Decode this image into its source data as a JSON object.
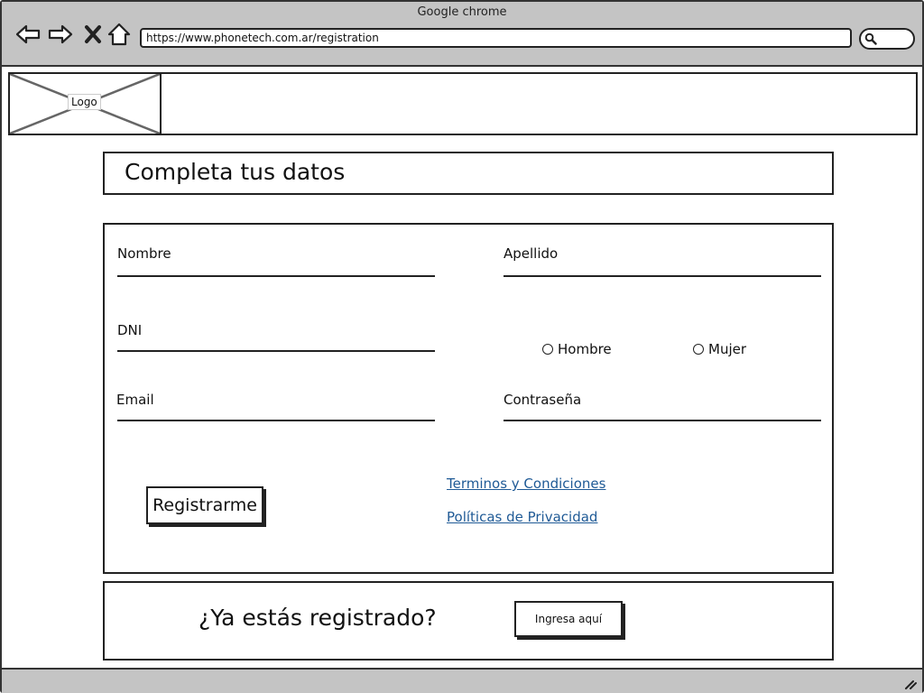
{
  "browser": {
    "window_title": "Google chrome",
    "url": "https://www.phonetech.com.ar/registration",
    "icons": [
      "back-arrow-icon",
      "forward-arrow-icon",
      "close-x-icon",
      "home-icon",
      "search-icon"
    ]
  },
  "header": {
    "logo_label": "Logo"
  },
  "page": {
    "title": "Completa tus datos"
  },
  "form": {
    "nombre_label": "Nombre",
    "apellido_label": "Apellido",
    "dni_label": "DNI",
    "email_label": "Email",
    "password_label": "Contraseña",
    "gender_options": [
      "Hombre",
      "Mujer"
    ],
    "register_button": "Registrarme",
    "terms_link": "Terminos y Condiciones",
    "privacy_link": "Políticas de Privacidad"
  },
  "footer": {
    "question": "¿Ya estás registrado?",
    "login_button": "Ingresa aquí"
  },
  "colors": {
    "chrome_gray": "#c4c4c4",
    "link_blue": "#1f5a96",
    "stroke": "#222222"
  }
}
